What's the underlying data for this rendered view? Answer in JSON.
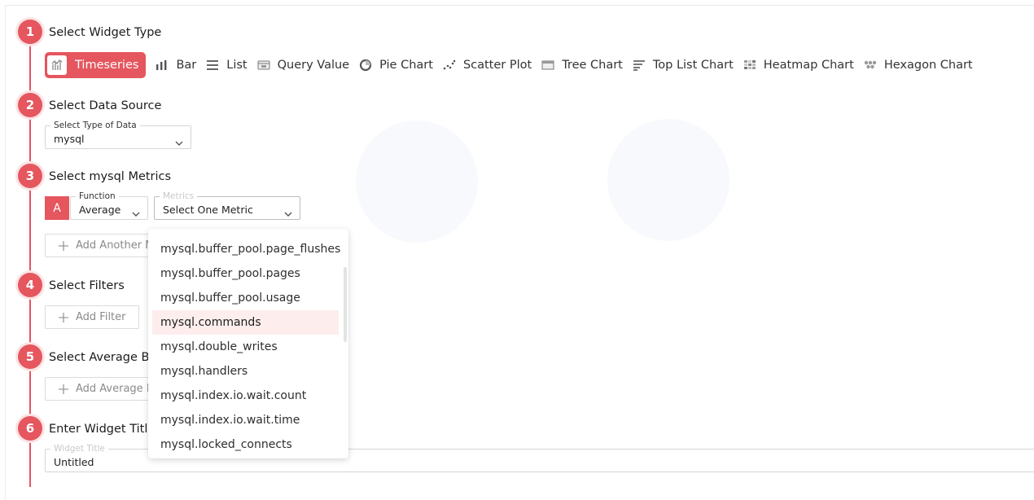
{
  "steps": [
    {
      "num": "1",
      "title": "Select Widget Type"
    },
    {
      "num": "2",
      "title": "Select Data Source"
    },
    {
      "num": "3",
      "title": "Select mysql Metrics"
    },
    {
      "num": "4",
      "title": "Select Filters"
    },
    {
      "num": "5",
      "title": "Select Average B"
    },
    {
      "num": "6",
      "title": "Enter Widget Titl"
    }
  ],
  "widget_types": [
    {
      "label": "Timeseries",
      "icon": "timeseries-icon",
      "active": true
    },
    {
      "label": "Bar",
      "icon": "bar-chart-icon"
    },
    {
      "label": "List",
      "icon": "list-icon"
    },
    {
      "label": "Query Value",
      "icon": "query-value-icon"
    },
    {
      "label": "Pie Chart",
      "icon": "pie-chart-icon"
    },
    {
      "label": "Scatter Plot",
      "icon": "scatter-plot-icon"
    },
    {
      "label": "Tree Chart",
      "icon": "tree-chart-icon"
    },
    {
      "label": "Top List Chart",
      "icon": "top-list-icon"
    },
    {
      "label": "Heatmap Chart",
      "icon": "heatmap-icon"
    },
    {
      "label": "Hexagon Chart",
      "icon": "hexagon-icon"
    }
  ],
  "data_source": {
    "label": "Select Type of Data",
    "value": "mysql"
  },
  "metrics": {
    "query_badge": "A",
    "function_label": "Function",
    "function_value": "Average",
    "metric_label": "Metrics",
    "metric_value": "Select One Metric",
    "add_another": "Add Another M"
  },
  "filters": {
    "add_filter": "Add Filter"
  },
  "average_by": {
    "add_average": "Add Average B"
  },
  "widget_title": {
    "label": "Widget Title",
    "value": "Untitled"
  },
  "metric_options": [
    "mysql.buffer_pool.page_flushes",
    "mysql.buffer_pool.pages",
    "mysql.buffer_pool.usage",
    "mysql.commands",
    "mysql.double_writes",
    "mysql.handlers",
    "mysql.index.io.wait.count",
    "mysql.index.io.wait.time",
    "mysql.locked_connects"
  ],
  "highlighted_option": "mysql.commands",
  "colors": {
    "accent": "#e5565e",
    "highlight": "#fdeeed"
  }
}
